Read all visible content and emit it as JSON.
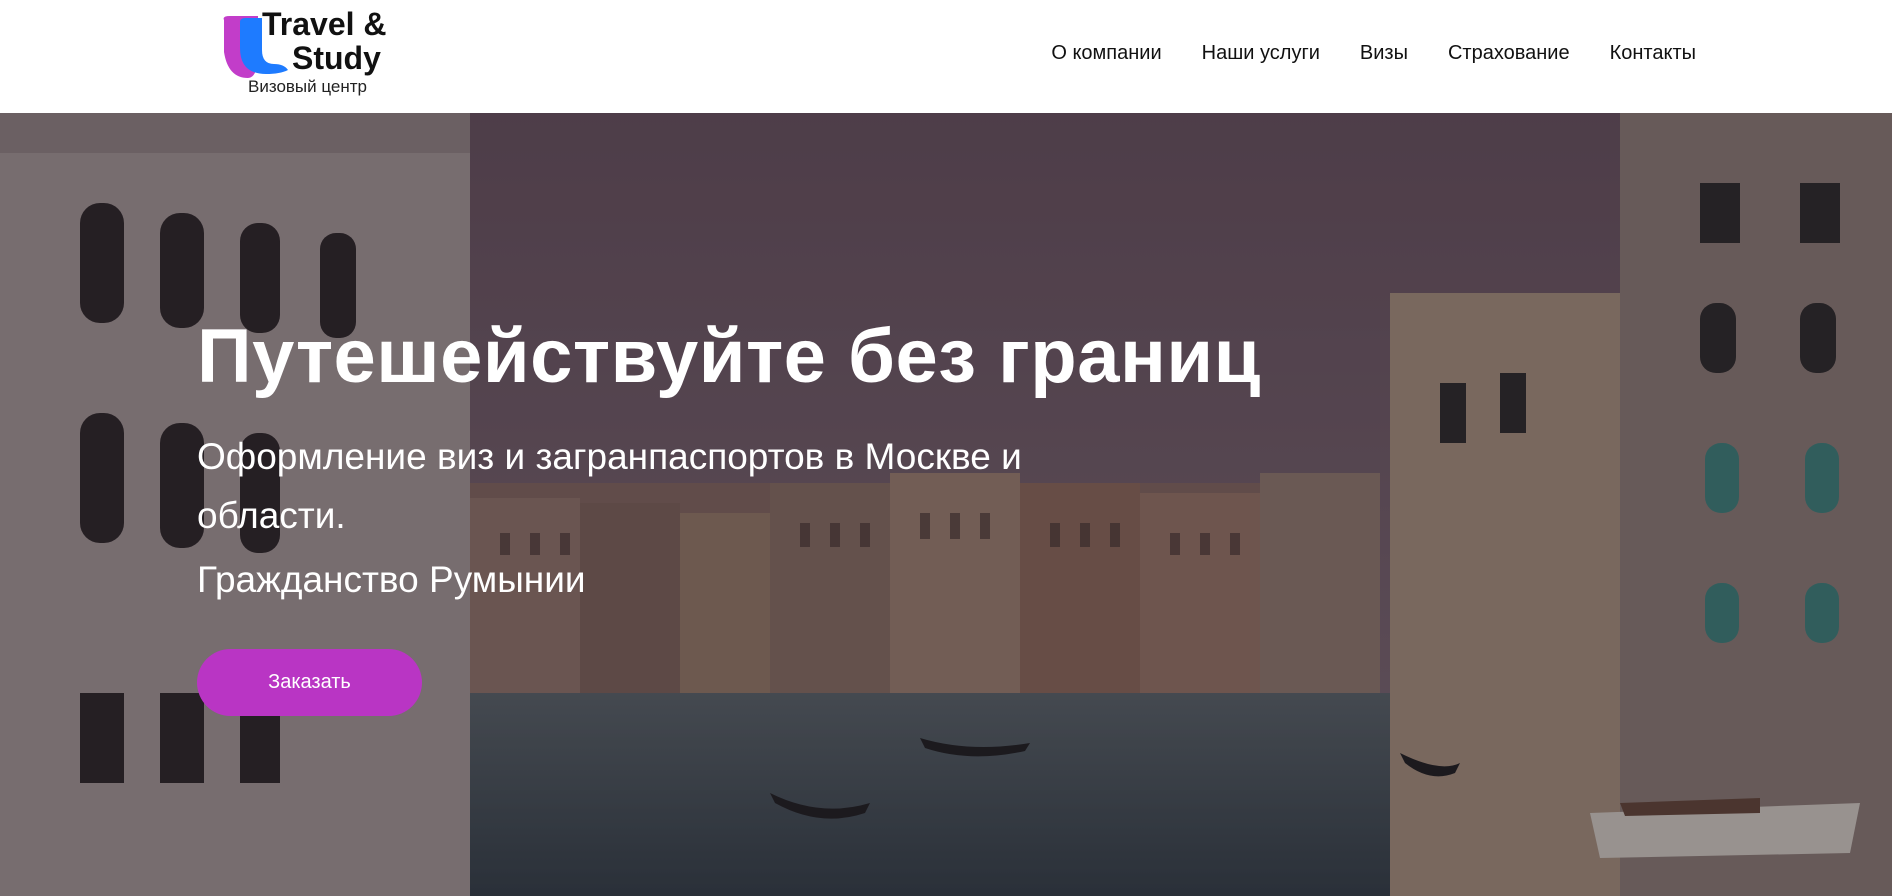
{
  "brand": {
    "name_line1": "Travel &",
    "name_line2": "Study",
    "subtitle": "Визовый центр",
    "colors": {
      "purple": "#c23dc9",
      "blue": "#1e7bff"
    }
  },
  "nav": {
    "items": [
      {
        "label": "О компании"
      },
      {
        "label": "Наши услуги"
      },
      {
        "label": "Визы"
      },
      {
        "label": "Страхование"
      },
      {
        "label": "Контакты"
      }
    ]
  },
  "hero": {
    "title": "Путешействуйте без границ",
    "subtitle": "Оформление виз и загранпаспортов в Москве и области.",
    "subtitle2": "Гражданство Румынии",
    "cta_label": "Заказать",
    "cta_color": "#b935c4",
    "background": "venice-canal-photo"
  }
}
